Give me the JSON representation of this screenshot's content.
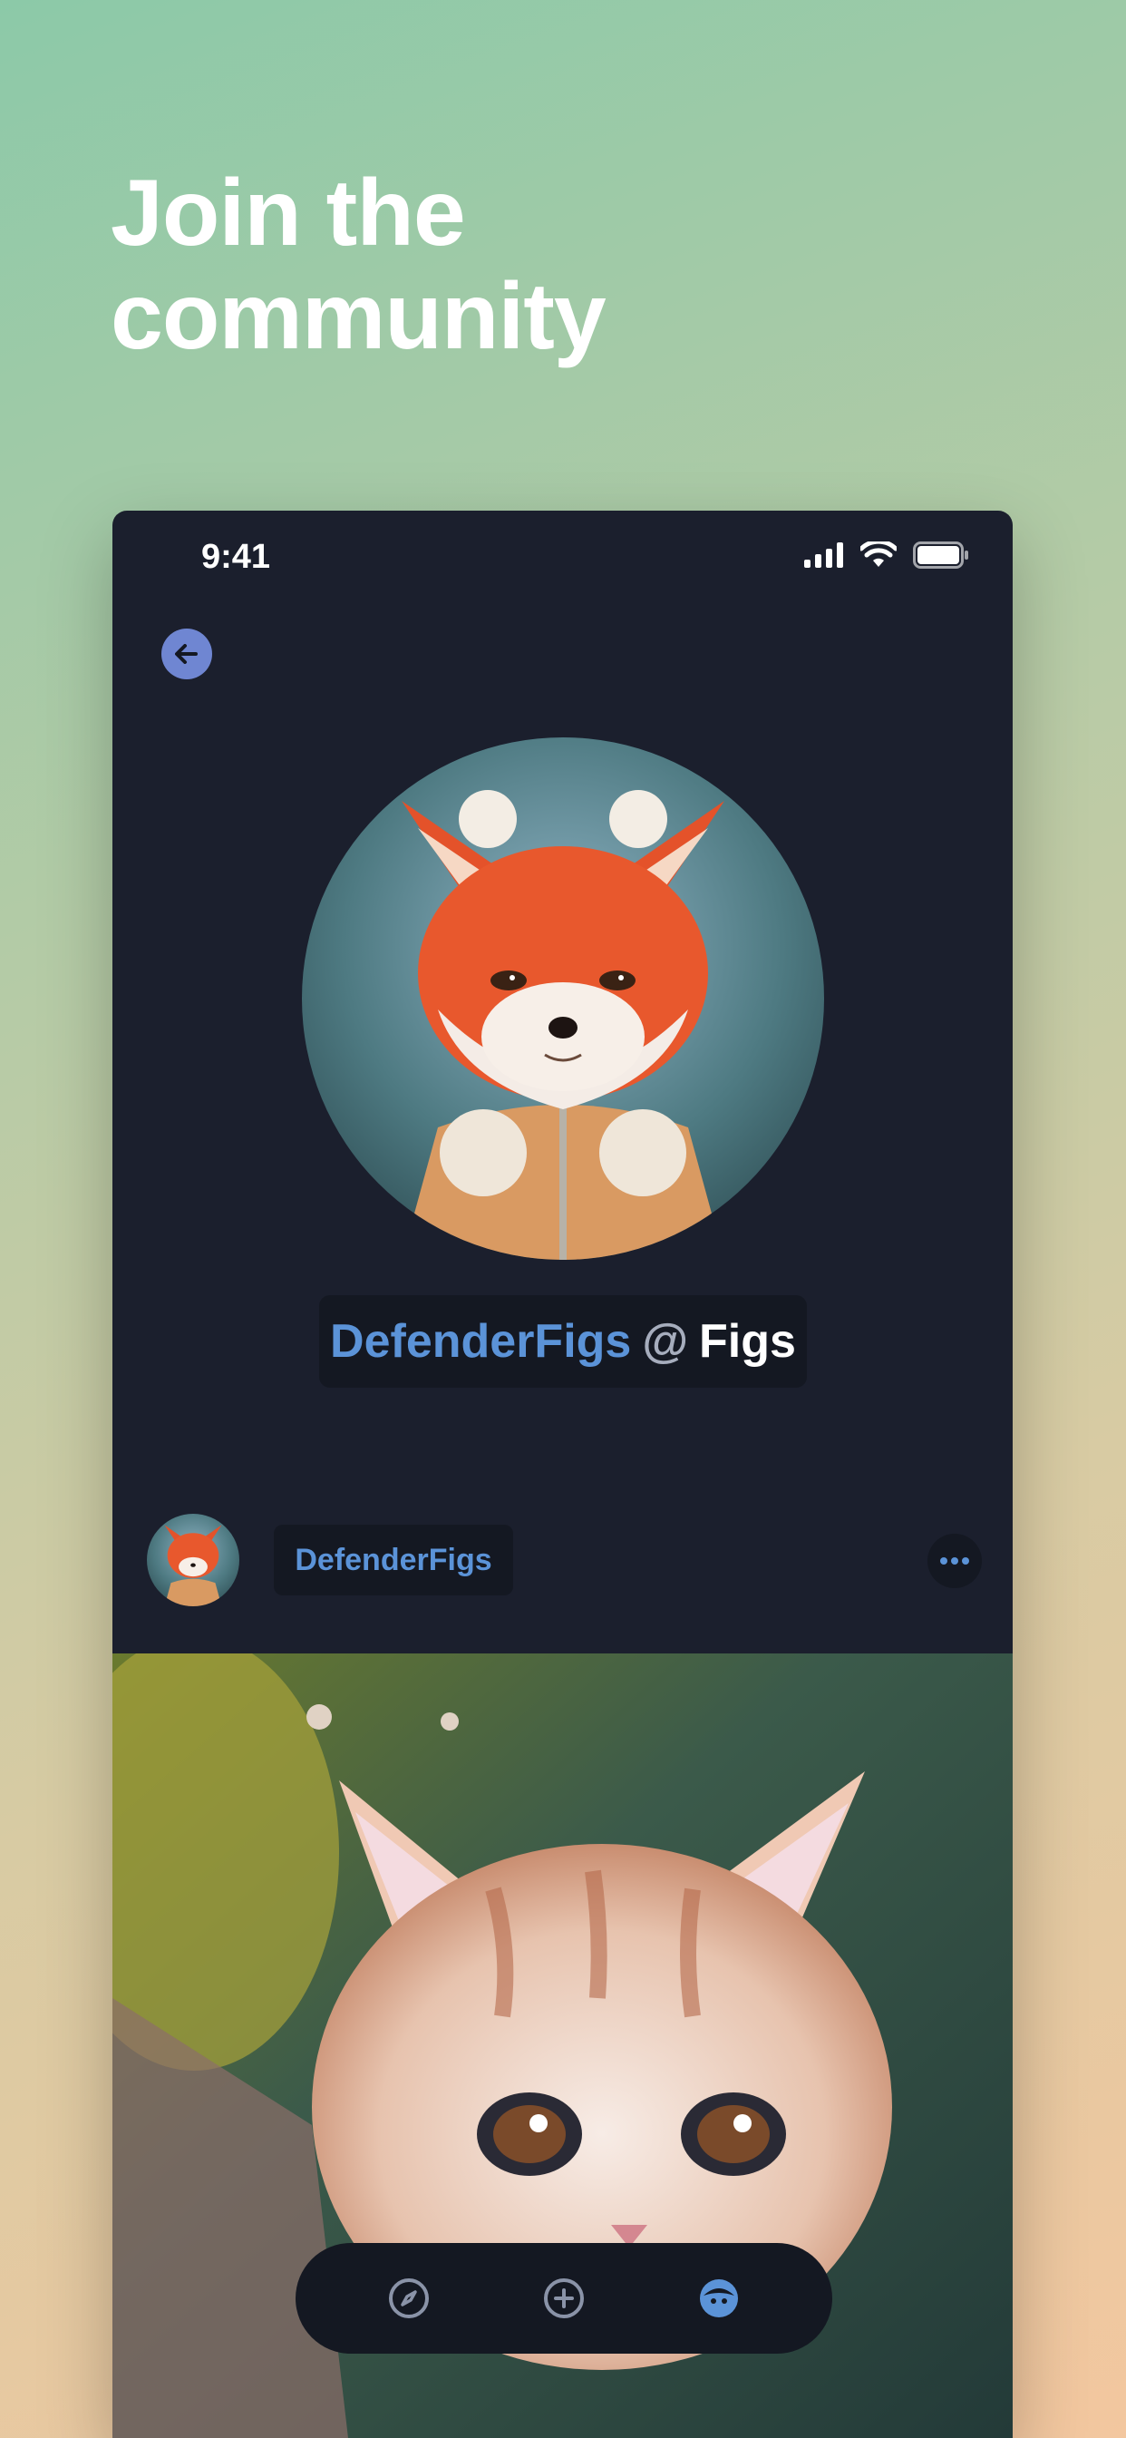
{
  "headline": {
    "line1": "Join the",
    "line2": "community"
  },
  "status_bar": {
    "time": "9:41"
  },
  "profile": {
    "username": "DefenderFigs",
    "at": "@",
    "community": "Figs"
  },
  "post": {
    "username": "DefenderFigs"
  },
  "tab_bar": {
    "items": [
      "compass-icon",
      "add-icon",
      "profile-icon"
    ]
  },
  "colors": {
    "background_card": "#1b1f2d",
    "pill": "#141822",
    "accent_blue": "#5b93d8",
    "back_button": "#6f86d2"
  }
}
